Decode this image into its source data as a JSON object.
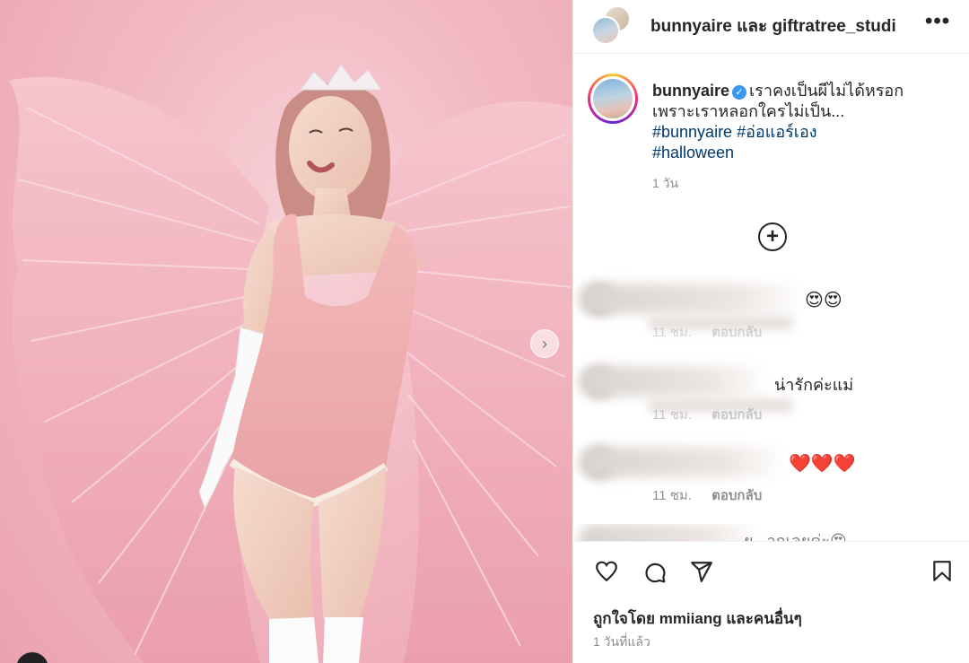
{
  "header": {
    "title": "bunnyaire และ giftratree_studi",
    "more_icon": "more-horizontal-icon"
  },
  "caption": {
    "username": "bunnyaire",
    "verified_icon": "verified-badge-icon",
    "line1": "เราคงเป็นผีไม่ได้หรอก",
    "line2": "เพราะเราหลอกใครไม่เป็น...",
    "hashtag1": "#bunnyaire",
    "hashtag2": "#อ่อแอร์เอง",
    "hashtag3": "#halloween",
    "time": "1 วัน"
  },
  "load_more_icon": "plus-circle-icon",
  "comments": [
    {
      "text": "😍😍",
      "time": "11 ชม.",
      "reply": "ตอบกลับ"
    },
    {
      "text": "น่ารักค่ะแม่",
      "time": "11 ชม.",
      "reply": "ตอบกลับ"
    },
    {
      "text": "❤️❤️❤️",
      "time": "11 ชม.",
      "reply": "ตอบกลับ"
    },
    {
      "text": "ย...ากเลยค่ะ😍"
    }
  ],
  "actions": {
    "like_icon": "heart-icon",
    "comment_icon": "comment-icon",
    "share_icon": "share-icon",
    "save_icon": "bookmark-icon"
  },
  "likes_text": "ถูกใจโดย mmiiang และคนอื่นๆ",
  "post_time": "1 วันที่แล้ว",
  "photo": {
    "next_icon": "chevron-right-icon"
  }
}
